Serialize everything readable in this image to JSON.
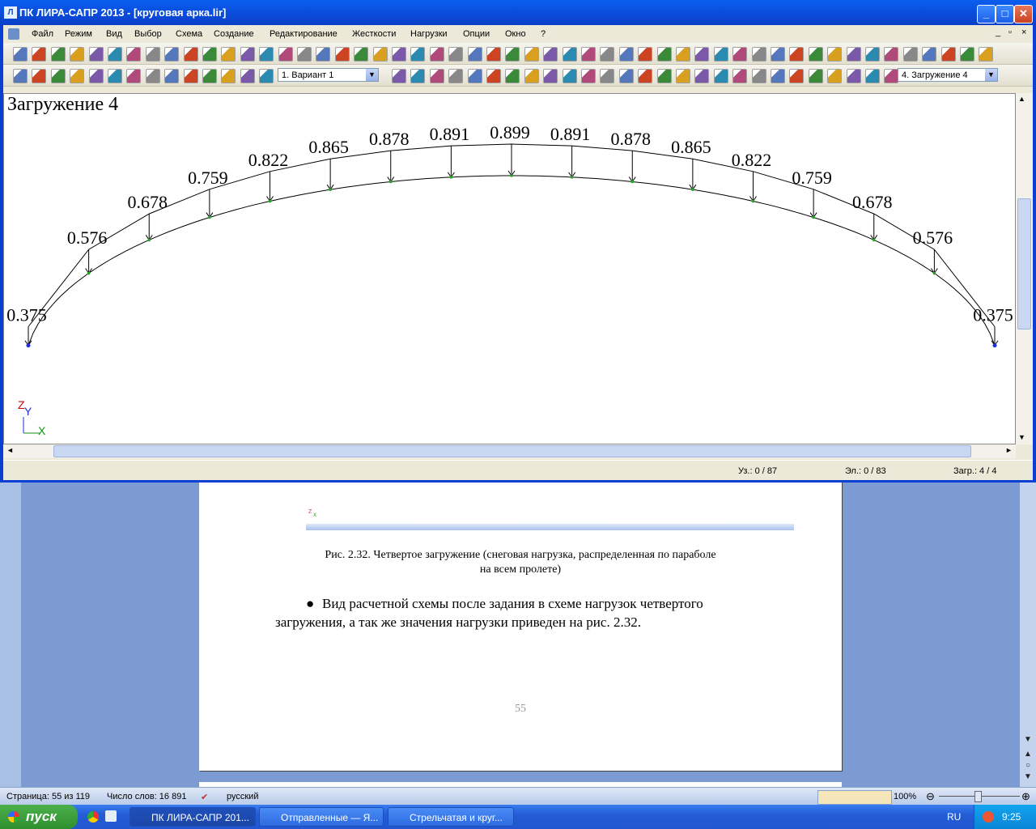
{
  "window": {
    "title": "ПК ЛИРА-САПР  2013 - [круговая арка.lir]"
  },
  "menu": [
    "Файл",
    "Режим",
    "Вид",
    "Выбор",
    "Схема",
    "Создание",
    "Редактирование",
    "Жесткости",
    "Нагрузки",
    "Опции",
    "Окно",
    "?"
  ],
  "toolbar": {
    "variant_select": "1. Вариант 1",
    "load_select": "4. Загружение 4"
  },
  "canvas": {
    "heading": "Загружение 4",
    "load_labels": [
      "0.375",
      "0.576",
      "0.678",
      "0.759",
      "0.822",
      "0.865",
      "0.878",
      "0.891",
      "0.899",
      "0.891",
      "0.878",
      "0.865",
      "0.822",
      "0.759",
      "0.678",
      "0.576",
      "0.375"
    ],
    "axis_z": "Z",
    "axis_y": "Y",
    "axis_x": "X"
  },
  "status": {
    "nodes": "Уз.: 0 / 87",
    "elements": "Эл.: 0 / 83",
    "loads": "Загр.: 4 / 4"
  },
  "document": {
    "caption_line1": "Рис. 2.32. Четвертое загружение (снеговая нагрузка, распределенная по параболе",
    "caption_line2": "на всем пролете)",
    "bullet_line1": "Вид расчетной схемы после задания в схеме нагрузок четвертого",
    "bullet_line2": "загружения, а так же значения нагрузки приведен на рис. 2.32.",
    "page_number": "55"
  },
  "word_status": {
    "page": "Страница: 55 из 119",
    "words": "Число слов: 16 891",
    "language": "русский",
    "zoom": "100%"
  },
  "taskbar": {
    "start": "пуск",
    "tasks": [
      "ПК ЛИРА-САПР 201...",
      "Отправленные — Я...",
      "Стрельчатая и круг..."
    ],
    "lang": "RU",
    "clock": "9:25"
  },
  "colors": {
    "title_blue": "#0b4ad8",
    "load_arrow": "#000000",
    "node_green": "#1fa81f",
    "support_blue": "#1a2fe0",
    "axis_z": "#d00000",
    "axis_y": "#1a2fe0",
    "axis_x": "#109010"
  }
}
